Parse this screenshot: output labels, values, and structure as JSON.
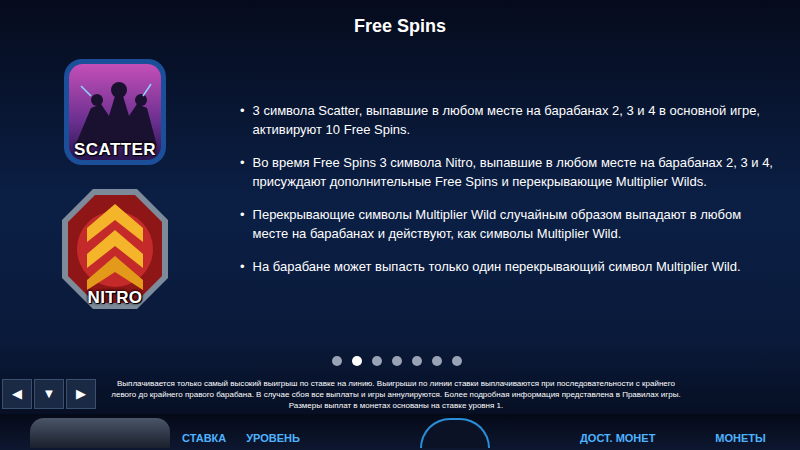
{
  "title": "Free Spins",
  "symbols": [
    {
      "label": "SCATTER",
      "kind": "scatter"
    },
    {
      "label": "NITRO",
      "kind": "nitro"
    }
  ],
  "bullet": "•",
  "rules": [
    "3 символа Scatter, выпавшие в любом месте на барабанах 2, 3 и 4 в основной игре, активируют 10 Free Spins.",
    "Во время Free Spins 3 символа Nitro, выпавшие в любом месте на барабанах 2, 3 и 4, присуждают дополнительные Free Spins и перекрывающие Multiplier Wilds.",
    "Перекрывающие символы Multiplier Wild случайным образом выпадают в любом месте на барабанах и действуют, как символы Multiplier Wild.",
    "На барабане может выпасть только один перекрывающий символ Multiplier Wild."
  ],
  "pagination": [
    {
      "selected": false
    },
    {
      "selected": true
    },
    {
      "selected": false
    },
    {
      "selected": false
    },
    {
      "selected": false
    },
    {
      "selected": false
    },
    {
      "selected": false
    }
  ],
  "nav": [
    "◀",
    "▼",
    "▶"
  ],
  "footer": "Выплачивается только самый высокий выигрыш по ставке на линию. Выигрыши по линии ставки выплачиваются при последовательности с крайнего левого до крайнего правого барабана. В случае сбоя все выплаты и игры аннулируются. Более подробная информация представлена в Правилах игры. Размеры выплат в монетах основаны на ставке уровня 1.",
  "bottom_bar": {
    "labels": [
      "СТАВКА",
      "УРОВЕНЬ",
      "ДОСТ. МОНЕТ",
      "МОНЕТЫ"
    ]
  }
}
